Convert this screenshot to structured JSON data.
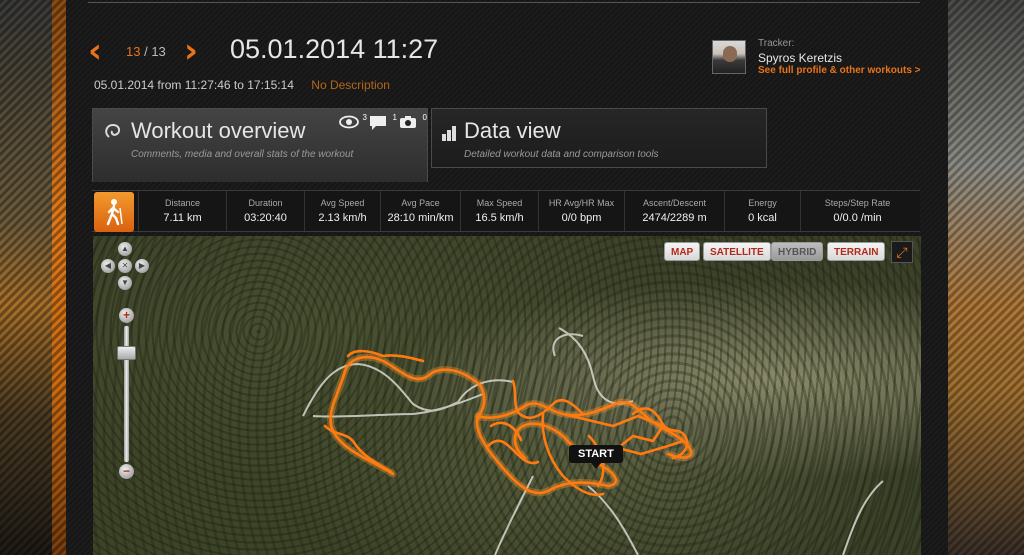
{
  "header": {
    "counter_current": "13",
    "counter_total": "/ 13",
    "title": "05.01.2014 11:27",
    "date_line": "05.01.2014 from 11:27:46 to 17:15:14",
    "description": "No Description",
    "prev_glyph": "‹",
    "next_glyph": "›"
  },
  "tracker": {
    "label": "Tracker:",
    "name": "Spyros Keretzis",
    "link": "See full profile & other workouts >"
  },
  "tabs": {
    "overview": {
      "title": "Workout overview",
      "subtitle": "Comments, media and overall stats of the workout",
      "counters": {
        "views": "3",
        "comments": "1",
        "photos": "0"
      }
    },
    "dataview": {
      "title": "Data view",
      "subtitle": "Detailed workout data and comparison tools"
    }
  },
  "stats": [
    {
      "label": "Distance",
      "value": "7.11 km"
    },
    {
      "label": "Duration",
      "value": "03:20:40"
    },
    {
      "label": "Avg Speed",
      "value": "2.13 km/h"
    },
    {
      "label": "Avg Pace",
      "value": "28:10 min/km"
    },
    {
      "label": "Max Speed",
      "value": "16.5 km/h"
    },
    {
      "label": "HR Avg/HR Max",
      "value": "0/0 bpm"
    },
    {
      "label": "Ascent/Descent",
      "value": "2474/2289 m"
    },
    {
      "label": "Energy",
      "value": "0 kcal"
    },
    {
      "label": "Steps/Step Rate",
      "value": "0/0.0 /min"
    }
  ],
  "map": {
    "buttons": {
      "map": "MAP",
      "satellite": "SATELLITE",
      "hybrid": "HYBRID",
      "terrain": "TERRAIN"
    },
    "selected": "HYBRID",
    "start_label": "START",
    "route_color": "#ff7a10"
  },
  "colors": {
    "accent": "#e8731a"
  }
}
